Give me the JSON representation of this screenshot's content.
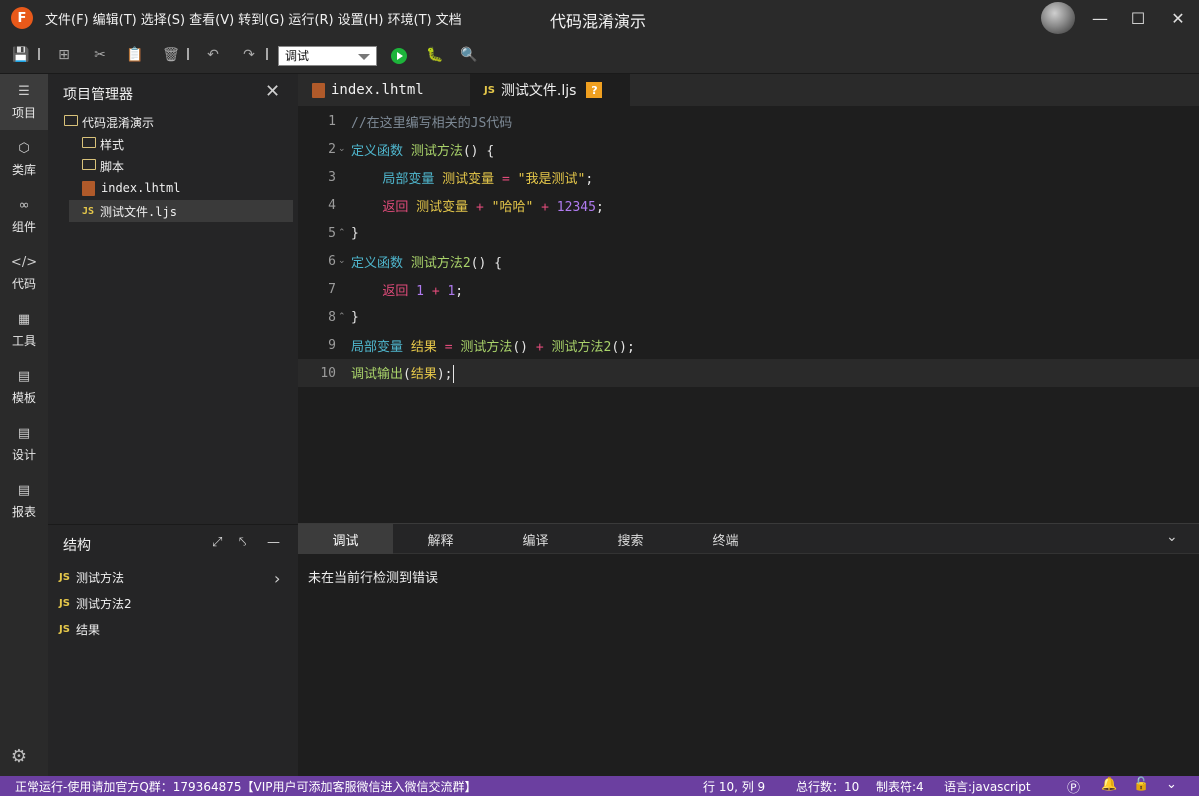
{
  "app": {
    "logo_letter": "F",
    "window_title": "代码混淆演示"
  },
  "menu": [
    "文件(F)",
    "编辑(T)",
    "选择(S)",
    "查看(V)",
    "转到(G)",
    "运行(R)",
    "设置(H)",
    "环境(T)",
    "文档"
  ],
  "toolbar": {
    "mode_value": "调试"
  },
  "activity": [
    "项目",
    "类库",
    "组件",
    "代码",
    "工具",
    "模板",
    "设计",
    "报表"
  ],
  "explorer": {
    "title": "项目管理器",
    "project": "代码混淆演示",
    "items": [
      "样式",
      "脚本",
      "index.lhtml",
      "测试文件.ljs"
    ]
  },
  "structure": {
    "title": "结构",
    "items": [
      "测试方法",
      "测试方法2",
      "结果"
    ]
  },
  "tabs": {
    "tab1": "index.lhtml",
    "tab2": "测试文件.ljs",
    "tab2_badge": "?"
  },
  "code": {
    "line_numbers": [
      "1",
      "2",
      "3",
      "4",
      "5",
      "6",
      "7",
      "8",
      "9",
      "10"
    ],
    "comment": "//在这里编写相关的JS代码",
    "kw_def": "定义函数",
    "kw_local": "局部变量",
    "kw_return": "返回",
    "fn1": "测试方法",
    "fn2": "测试方法2",
    "var1": "测试变量",
    "var2": "结果",
    "str1": "\"我是测试\"",
    "str2": "\"哈哈\"",
    "num1": "12345",
    "num2": "1",
    "num3": "1",
    "fn_debug": "调试输出"
  },
  "panel": {
    "tabs": [
      "调试",
      "解释",
      "编译",
      "搜索",
      "终端"
    ],
    "message": "未在当前行检测到错误"
  },
  "status": {
    "text": "正常运行-使用请加官方Q群：179364875【VIP用户可添加客服微信进入微信交流群】",
    "position": "行 10, 列 9",
    "total_lines": "总行数：10",
    "tab_size": "制表符:4",
    "language": "语言:javascript"
  }
}
